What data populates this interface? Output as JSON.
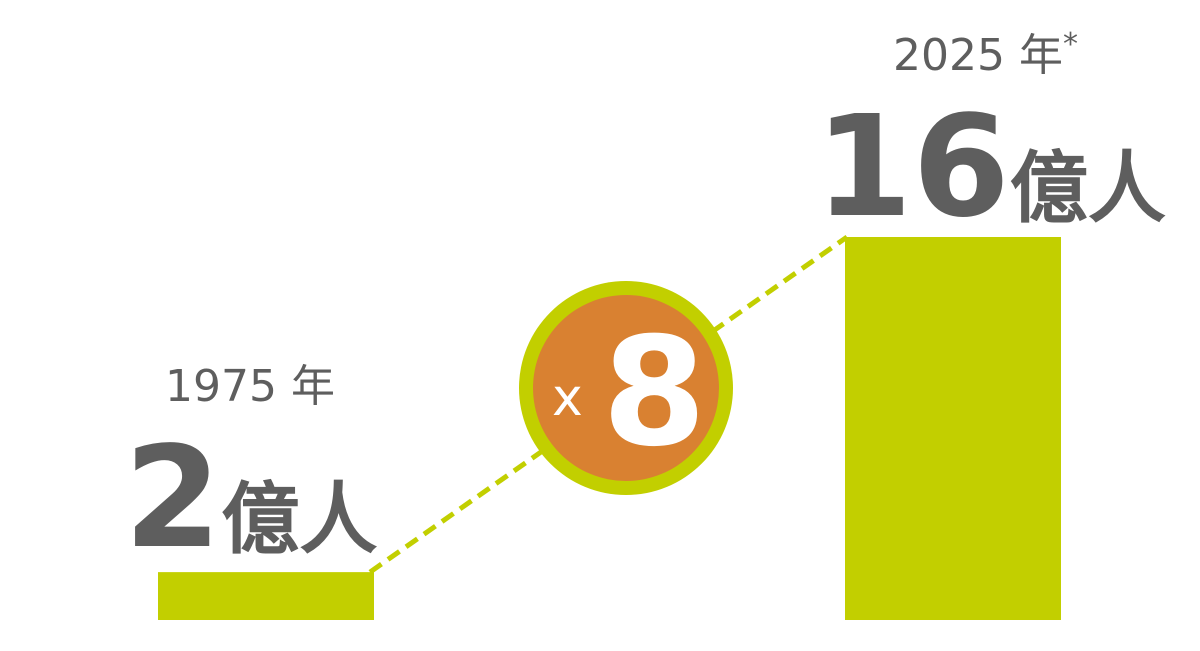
{
  "colors": {
    "bar": "#c2cf00",
    "text": "#5e5e5e",
    "badge_fill": "#d98131",
    "badge_ring": "#c2cf00",
    "badge_text": "#ffffff"
  },
  "chart_data": {
    "type": "bar",
    "categories": [
      "1975 年",
      "2025 年*"
    ],
    "values": [
      2,
      16
    ],
    "value_labels": [
      {
        "number": "2",
        "unit": "億人"
      },
      {
        "number": "16",
        "unit": "億人"
      }
    ],
    "year_labels": [
      {
        "text": "1975 年",
        "note": ""
      },
      {
        "text": "2025 年",
        "note": "*"
      }
    ],
    "multiplier": {
      "prefix": "x",
      "value": "8"
    },
    "ylim": [
      0,
      16
    ],
    "grid": false
  }
}
